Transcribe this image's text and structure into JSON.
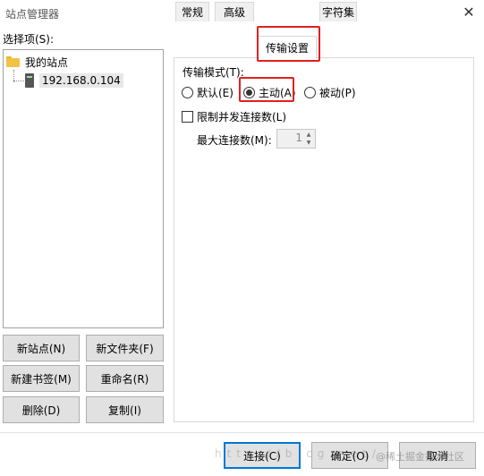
{
  "window": {
    "title": "站点管理器",
    "close": "✕"
  },
  "tree": {
    "label": "选择项(S):",
    "root": "我的站点",
    "site": "192.168.0.104"
  },
  "left_buttons": {
    "new_site": "新站点(N)",
    "new_folder": "新文件夹(F)",
    "new_bookmark": "新建书签(M)",
    "rename": "重命名(R)",
    "delete": "删除(D)",
    "copy": "复制(I)"
  },
  "tabs": [
    "常规",
    "高级",
    "传输设置",
    "字符集"
  ],
  "active_tab": "传输设置",
  "transfer": {
    "mode_label": "传输模式(T):",
    "options": {
      "default": "默认(E)",
      "active": "主动(A)",
      "passive": "被动(P)"
    },
    "selected": "主动(A)",
    "limit_label": "限制并发连接数(L)",
    "limit_checked": false,
    "max_conn_label": "最大连接数(M):",
    "max_conn_value": "1"
  },
  "footer": {
    "connect": "连接(C)",
    "ok": "确定(O)",
    "cancel": "取消"
  },
  "watermark": {
    "url": "http://b.cg.net/",
    "credit": "@稀土掘金技术社区"
  },
  "colors": {
    "highlight": "#e02020",
    "default_button_border": "#0078d7"
  }
}
